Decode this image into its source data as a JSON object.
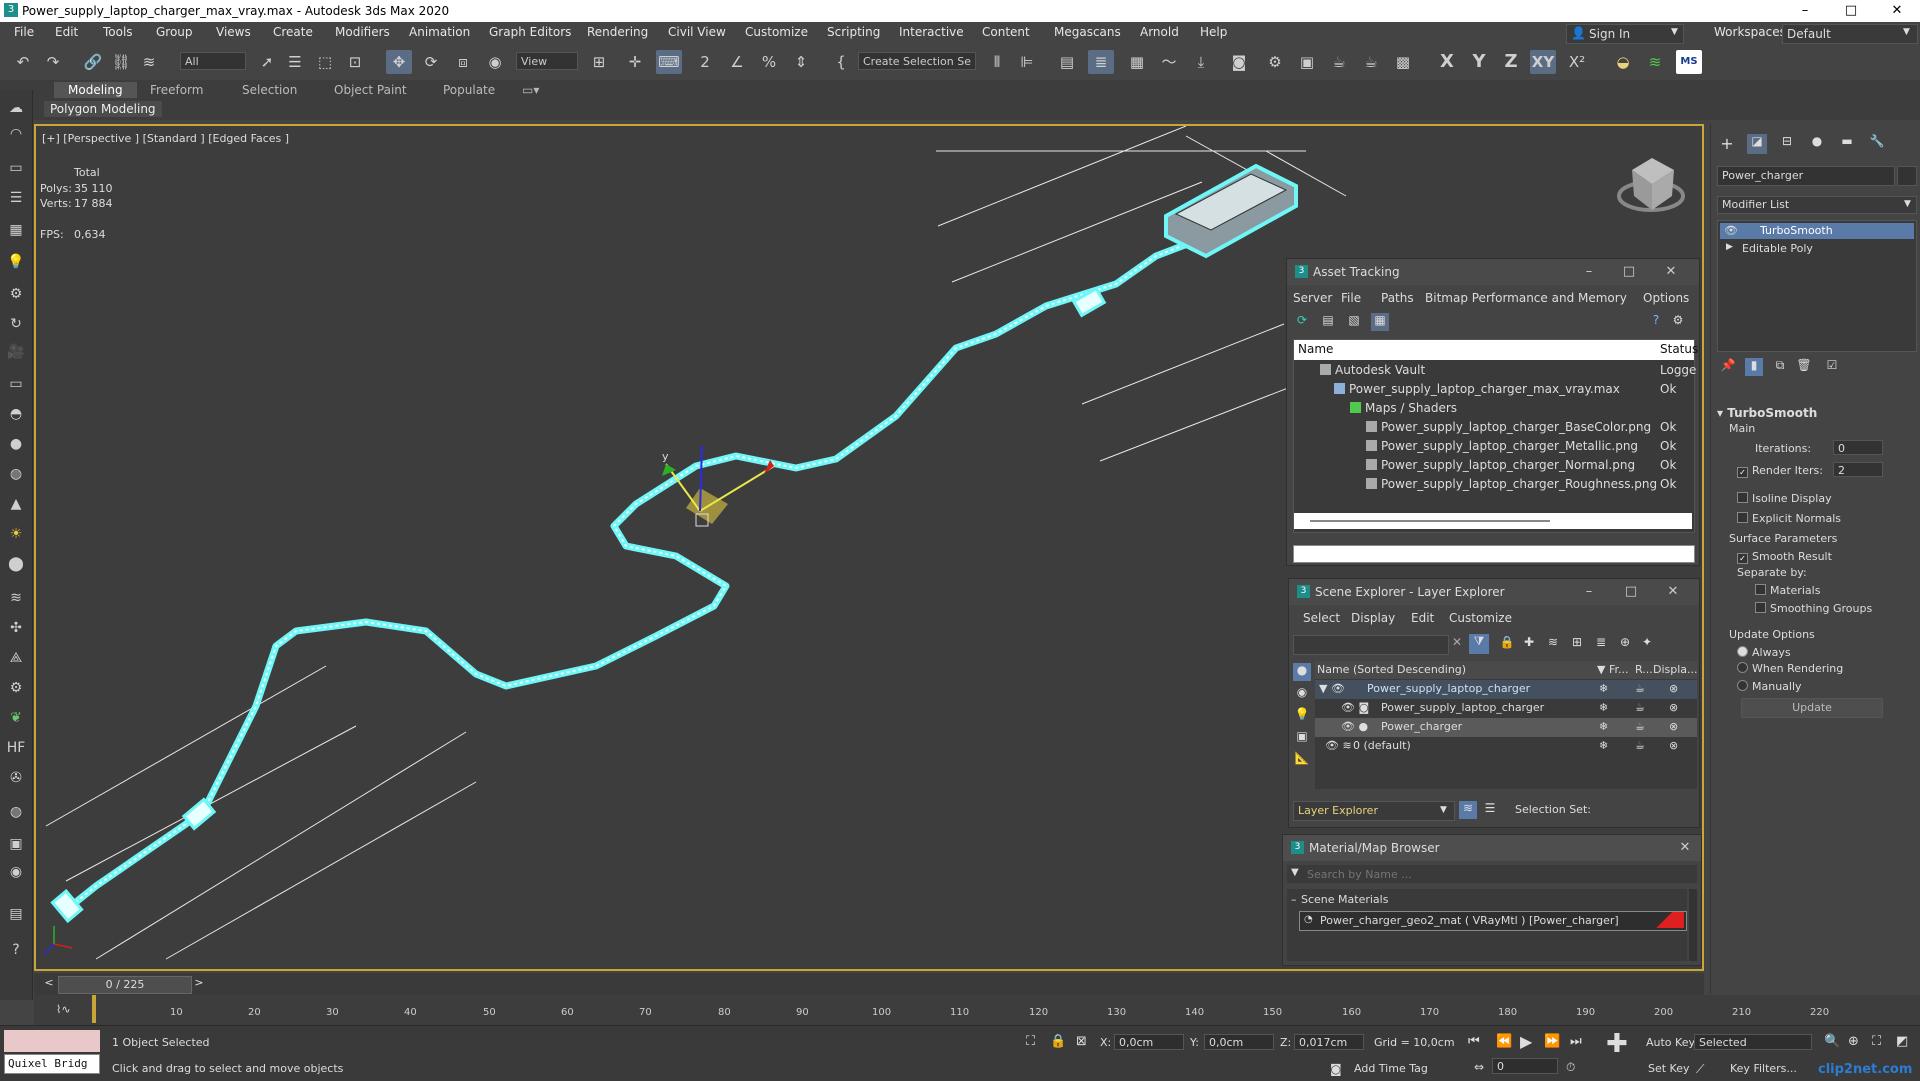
{
  "window": {
    "title": "Power_supply_laptop_charger_max_vray.max - Autodesk 3ds Max 2020",
    "minimize": "–",
    "maximize": "□",
    "close": "✕"
  },
  "menu": [
    "File",
    "Edit",
    "Tools",
    "Group",
    "Views",
    "Create",
    "Modifiers",
    "Animation",
    "Graph Editors",
    "Rendering",
    "Civil View",
    "Customize",
    "Scripting",
    "Interactive",
    "Content",
    "Megascans",
    "Arnold",
    "Help"
  ],
  "account": {
    "sign_in": "Sign In",
    "workspaces_label": "Workspaces:",
    "workspace": "Default"
  },
  "toolbar": {
    "filter": "All",
    "view": "View",
    "selection_set": "Create Selection Se",
    "axis_x": "X",
    "axis_y": "Y",
    "axis_z": "Z",
    "axis_xy": "XY",
    "ms": "MS"
  },
  "ribbon": {
    "tabs": [
      "Modeling",
      "Freeform",
      "Selection",
      "Object Paint",
      "Populate"
    ],
    "active": "Modeling",
    "sub": "Polygon Modeling"
  },
  "viewport": {
    "label": "[+] [Perspective ] [Standard ] [Edged Faces ]",
    "stats": {
      "total": "Total",
      "polys_label": "Polys:",
      "polys": "35 110",
      "verts_label": "Verts:",
      "verts": "17 884",
      "fps_label": "FPS:",
      "fps": "0,634"
    },
    "gizmo_y": "y"
  },
  "asset_tracking": {
    "title": "Asset Tracking",
    "menu": [
      "Server",
      "File",
      "Paths",
      "Bitmap Performance and Memory",
      "Options"
    ],
    "col_name": "Name",
    "col_status": "Status",
    "rows": [
      {
        "name": "Autodesk Vault",
        "status": "Logge",
        "indent": 0
      },
      {
        "name": "Power_supply_laptop_charger_max_vray.max",
        "status": "Ok",
        "indent": 1
      },
      {
        "name": "Maps / Shaders",
        "status": "",
        "indent": 2
      },
      {
        "name": "Power_supply_laptop_charger_BaseColor.png",
        "status": "Ok",
        "indent": 3
      },
      {
        "name": "Power_supply_laptop_charger_Metallic.png",
        "status": "Ok",
        "indent": 3
      },
      {
        "name": "Power_supply_laptop_charger_Normal.png",
        "status": "Ok",
        "indent": 3
      },
      {
        "name": "Power_supply_laptop_charger_Roughness.png",
        "status": "Ok",
        "indent": 3
      }
    ]
  },
  "scene_explorer": {
    "title": "Scene Explorer - Layer Explorer",
    "menu": [
      "Select",
      "Display",
      "Edit",
      "Customize"
    ],
    "col_name": "Name (Sorted Descending)",
    "col_fr": "▼ Fr...",
    "col_r": "R...",
    "col_disp": "Displa...",
    "rows": [
      {
        "name": "Power_supply_laptop_charger",
        "indent": 0,
        "highlight": true
      },
      {
        "name": "Power_supply_laptop_charger",
        "indent": 1,
        "highlight": false
      },
      {
        "name": "Power_charger",
        "indent": 1,
        "highlight": true
      },
      {
        "name": "0 (default)",
        "indent": 0,
        "highlight": false
      }
    ],
    "layer_explorer": "Layer Explorer",
    "selection_set": "Selection Set:"
  },
  "material_browser": {
    "title": "Material/Map Browser",
    "search_placeholder": "Search by Name ...",
    "section": "Scene Materials",
    "material": "Power_charger_geo2_mat ( VRayMtl ) [Power_charger]",
    "material_color": "#e02020"
  },
  "command_panel": {
    "object_name": "Power_charger",
    "modifier_list": "Modifier List",
    "stack": [
      "TurboSmooth",
      "Editable Poly"
    ],
    "rollout": "TurboSmooth",
    "main": "Main",
    "iterations_label": "Iterations:",
    "iterations": "0",
    "render_iters_label": "Render Iters:",
    "render_iters": "2",
    "isoline": "Isoline Display",
    "explicit_normals": "Explicit Normals",
    "surface_params": "Surface Parameters",
    "smooth_result": "Smooth Result",
    "separate_by": "Separate by:",
    "materials": "Materials",
    "smoothing_groups": "Smoothing Groups",
    "update_options": "Update Options",
    "always": "Always",
    "when_rendering": "When Rendering",
    "manually": "Manually",
    "update": "Update"
  },
  "timeline": {
    "frame": "0 / 225",
    "prev": "<",
    "next": ">",
    "ticks": [
      "10",
      "20",
      "30",
      "40",
      "50",
      "60",
      "70",
      "80",
      "90",
      "100",
      "110",
      "120",
      "130",
      "140",
      "150",
      "160",
      "170",
      "180",
      "190",
      "200",
      "210",
      "220"
    ]
  },
  "status": {
    "quixel": "Quixel Bridg",
    "selected": "1 Object Selected",
    "hint": "Click and drag to select and move objects",
    "x_label": "X:",
    "x": "0,0cm",
    "y_label": "Y:",
    "y": "0,0cm",
    "z_label": "Z:",
    "z": "0,017cm",
    "grid": "Grid = 10,0cm",
    "add_time_tag": "Add Time Tag",
    "auto_key": "Auto Key",
    "set_key": "Set Key",
    "key_mode": "Selected",
    "key_filters": "Key Filters...",
    "frame": "0",
    "watermark": "clip2net.com"
  },
  "colors": {
    "accent": "#5a7ba8",
    "highlight": "#6ff6f6",
    "viewport_border": "#c9a53a"
  }
}
